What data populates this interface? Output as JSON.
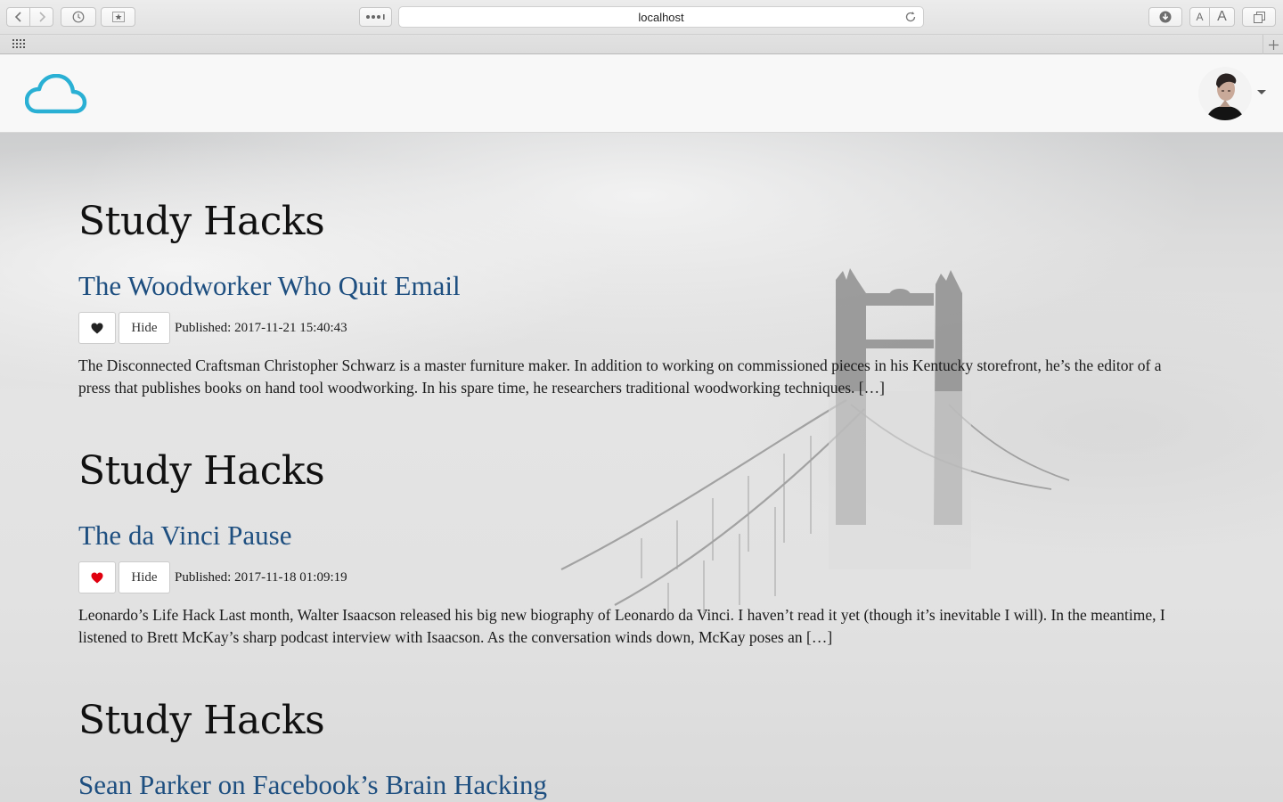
{
  "browser": {
    "address": "localhost"
  },
  "colors": {
    "logo": "#2ab0d4",
    "title_link": "#1e4f80",
    "liked_heart": "#e0000f",
    "unliked_heart": "#222222"
  },
  "icons": {
    "back": "chevron-left-icon",
    "forward": "chevron-right-icon",
    "history": "clock-icon",
    "bookmarks": "star-icon",
    "reader": "dots-icon",
    "reload": "reload-icon",
    "download": "download-icon",
    "tabs": "tabs-icon",
    "apps": "grid-icon",
    "new_tab": "plus-icon",
    "logo": "cloud-icon",
    "like": "heart-icon",
    "menu": "caret-down-icon"
  },
  "toolbar": {
    "font_small": "A",
    "font_large": "A"
  },
  "feed": [
    {
      "source": "Study Hacks",
      "title": "The Woodworker Who Quit Email",
      "liked": false,
      "hide_label": "Hide",
      "published": "Published: 2017-11-21 15:40:43",
      "excerpt": "The Disconnected Craftsman Christopher Schwarz is a master furniture maker. In addition to working on commissioned pieces in his Kentucky storefront, he’s the editor of a press that publishes books on hand tool woodworking. In his spare time, he researchers traditional woodworking techniques. […]"
    },
    {
      "source": "Study Hacks",
      "title": "The da Vinci Pause",
      "liked": true,
      "hide_label": "Hide",
      "published": "Published: 2017-11-18 01:09:19",
      "excerpt": "Leonardo’s Life Hack Last month, Walter Isaacson released his big new biography of Leonardo da Vinci. I haven’t read it yet (though it’s inevitable I will). In the meantime, I listened to Brett McKay’s sharp podcast interview with Isaacson. As the conversation winds down, McKay poses an […]"
    },
    {
      "source": "Study Hacks",
      "title": "Sean Parker on Facebook’s Brain Hacking"
    }
  ]
}
